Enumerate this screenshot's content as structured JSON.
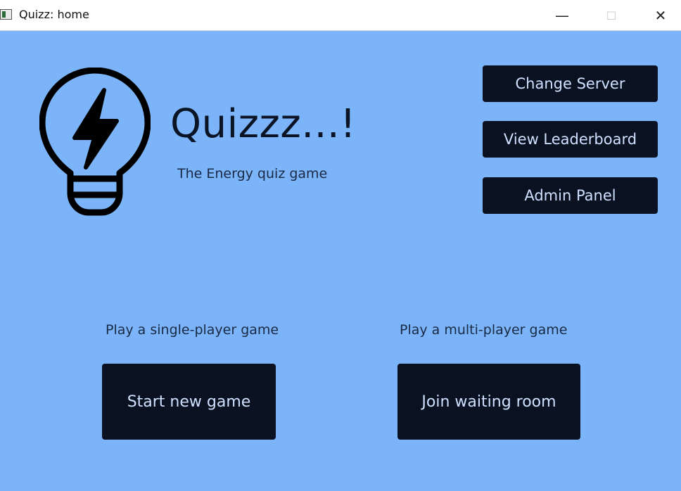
{
  "window": {
    "title": "Quizz: home",
    "controls": {
      "minimize": "—",
      "maximize": "☐",
      "close": "✕"
    }
  },
  "header": {
    "title": "Quizzz...!",
    "subtitle": "The Energy quiz game",
    "logo_icon": "lightbulb-bolt-icon"
  },
  "menu": {
    "change_server": "Change Server",
    "view_leaderboard": "View Leaderboard",
    "admin_panel": "Admin Panel"
  },
  "single_player": {
    "label": "Play a single-player game",
    "button": "Start new game"
  },
  "multi_player": {
    "label": "Play a multi-player game",
    "button": "Join waiting room"
  },
  "colors": {
    "background": "#7bb4f8",
    "button_bg": "#0a1222",
    "button_text": "#cfe0ff"
  }
}
